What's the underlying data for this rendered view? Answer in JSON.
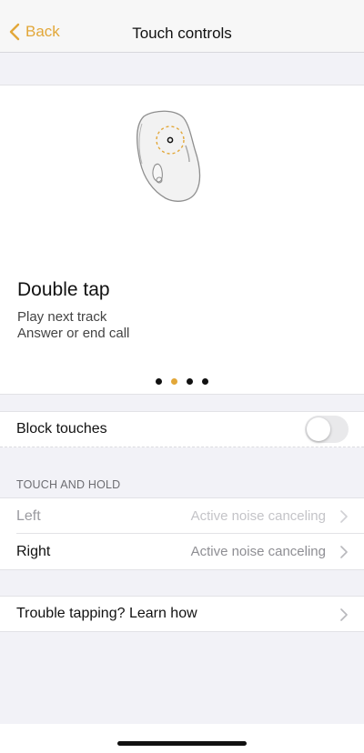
{
  "nav": {
    "back_label": "Back",
    "title": "Touch controls"
  },
  "gesture": {
    "title": "Double tap",
    "actions": [
      "Play next track",
      "Answer or end call"
    ],
    "pager": {
      "count": 4,
      "active_index": 1
    }
  },
  "block_touches": {
    "label": "Block touches",
    "enabled": false
  },
  "touch_and_hold": {
    "header": "TOUCH AND HOLD",
    "rows": [
      {
        "label": "Left",
        "value": "Active noise canceling"
      },
      {
        "label": "Right",
        "value": "Active noise canceling"
      }
    ]
  },
  "help": {
    "label": "Trouble tapping? Learn how"
  },
  "colors": {
    "accent": "#e2a739",
    "background": "#f2f2f7"
  },
  "icons": {
    "back": "chevron-left-icon",
    "disclosure": "chevron-right-icon"
  }
}
